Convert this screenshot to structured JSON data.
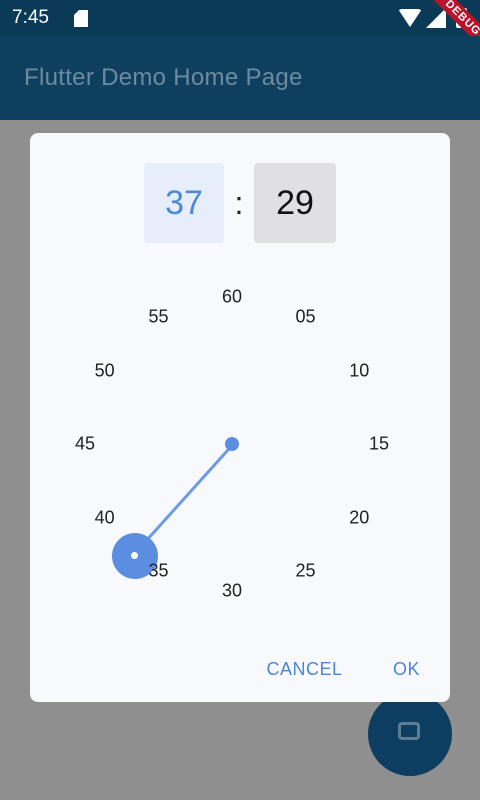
{
  "status_bar": {
    "time": "7:45",
    "debug_label": "DEBUG"
  },
  "app_bar": {
    "title": "Flutter Demo Home Page"
  },
  "time_picker": {
    "hour": "37",
    "separator": ":",
    "minute": "29",
    "dial_labels": [
      "60",
      "05",
      "10",
      "15",
      "20",
      "25",
      "30",
      "35",
      "40",
      "45",
      "50",
      "55"
    ],
    "selected_value": 37,
    "actions": {
      "cancel": "CANCEL",
      "ok": "OK"
    }
  },
  "fab": {
    "icon": "add-icon"
  },
  "colors": {
    "accent": "#5b8ee0",
    "app_bar": "#0f3f5e",
    "dialog_bg": "#f8f9fc",
    "debug_banner": "#b8142c"
  }
}
